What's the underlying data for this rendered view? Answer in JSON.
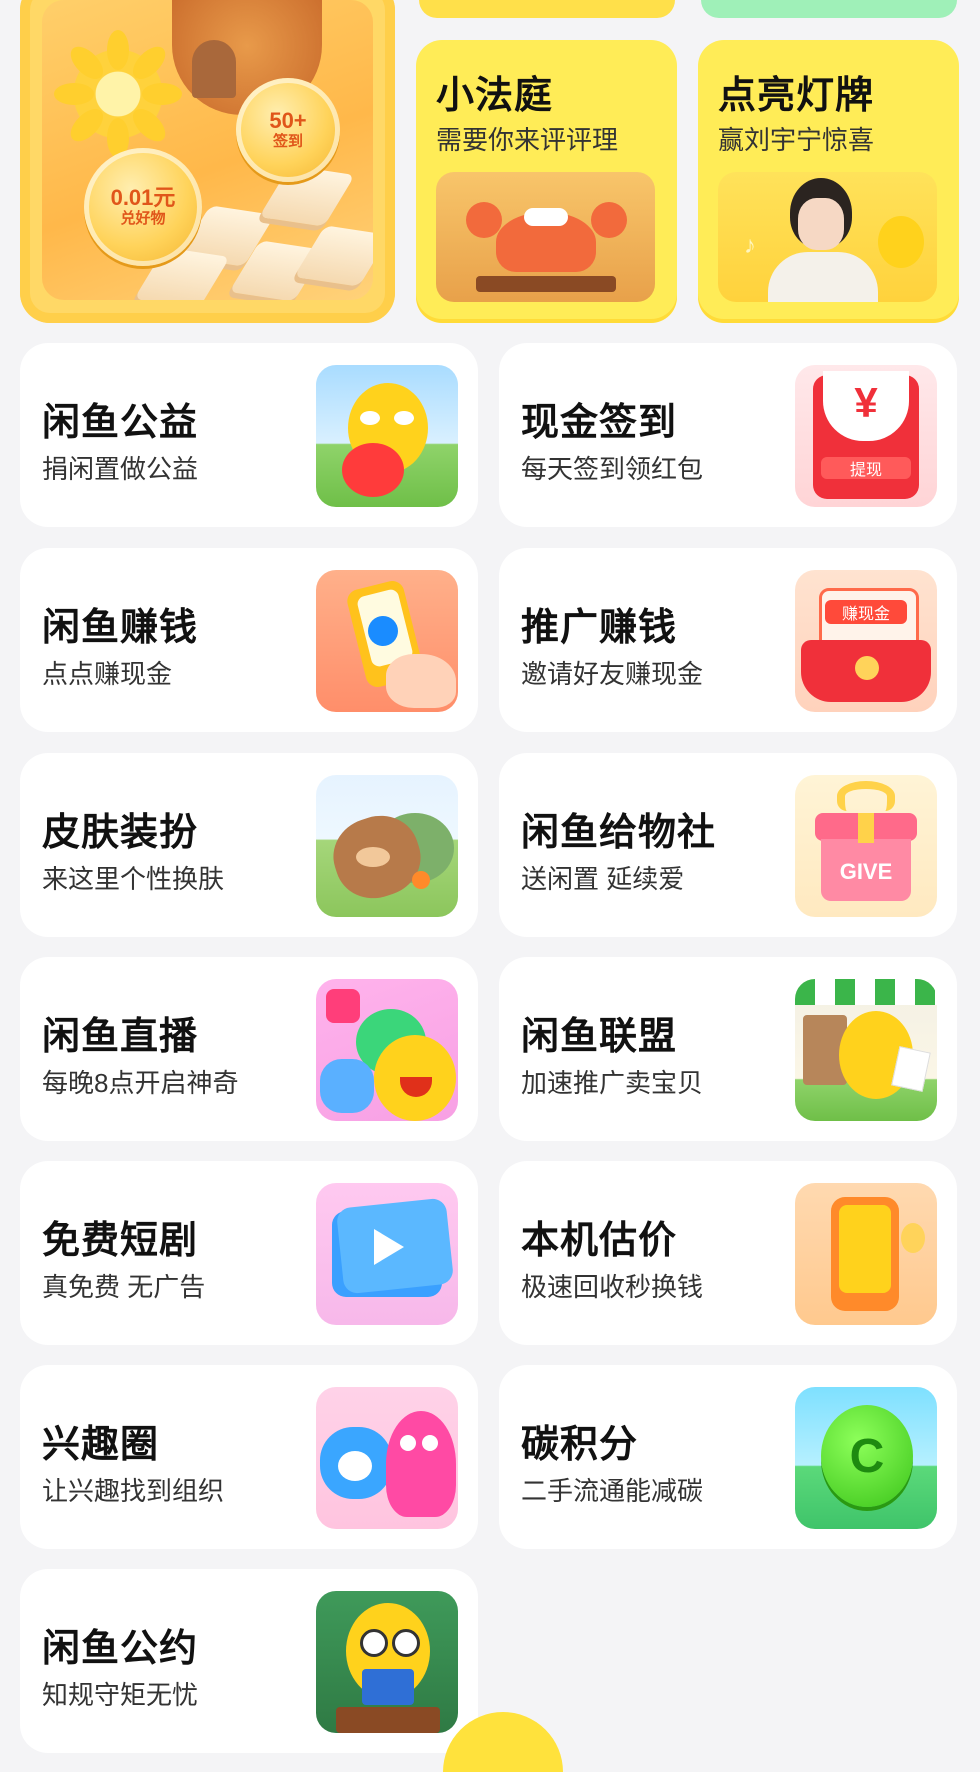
{
  "top_promos": [
    {
      "title": "小法庭",
      "subtitle": "需要你来评评理",
      "icon": "crab-judge-gavel-icon"
    },
    {
      "title": "点亮灯牌",
      "subtitle": "赢刘宇宁惊喜",
      "icon": "celebrity-photo-icon"
    }
  ],
  "banner": {
    "coin_left_value": "0.01元",
    "coin_left_label": "兑好物",
    "coin_right_value": "50+",
    "coin_right_label": "签到"
  },
  "grid": [
    {
      "title": "闲鱼公益",
      "subtitle": "捐闲置做公益",
      "icon": "fish-heart-icon"
    },
    {
      "title": "现金签到",
      "subtitle": "每天签到领红包",
      "icon": "red-envelope-yuan-icon",
      "badge": "提现",
      "symbol": "¥"
    },
    {
      "title": "闲鱼赚钱",
      "subtitle": "点点赚现金",
      "icon": "phone-in-hand-icon"
    },
    {
      "title": "推广赚钱",
      "subtitle": "邀请好友赚现金",
      "icon": "cash-envelope-icon",
      "badge": "赚现金"
    },
    {
      "title": "皮肤装扮",
      "subtitle": "来这里个性换肤",
      "icon": "capybara-skin-icon"
    },
    {
      "title": "闲鱼给物社",
      "subtitle": "送闲置 延续爱",
      "icon": "gift-box-icon",
      "badge": "GIVE"
    },
    {
      "title": "闲鱼直播",
      "subtitle": "每晚8点开启神奇",
      "icon": "live-characters-icon"
    },
    {
      "title": "闲鱼联盟",
      "subtitle": "加速推广卖宝贝",
      "icon": "fish-shop-icon"
    },
    {
      "title": "免费短剧",
      "subtitle": "真免费 无广告",
      "icon": "video-play-icon"
    },
    {
      "title": "本机估价",
      "subtitle": "极速回收秒换钱",
      "icon": "phone-valuation-icon"
    },
    {
      "title": "兴趣圈",
      "subtitle": "让兴趣找到组织",
      "icon": "interest-monsters-icon"
    },
    {
      "title": "碳积分",
      "subtitle": "二手流通能减碳",
      "icon": "carbon-coin-icon",
      "symbol": "C"
    },
    {
      "title": "闲鱼公约",
      "subtitle": "知规守矩无忧",
      "icon": "fish-rulebook-icon"
    }
  ],
  "colors": {
    "background": "#f4f4f6",
    "card": "#ffffff",
    "promo_yellow": "#ffec57",
    "brand_yellow": "#ffe23c"
  }
}
